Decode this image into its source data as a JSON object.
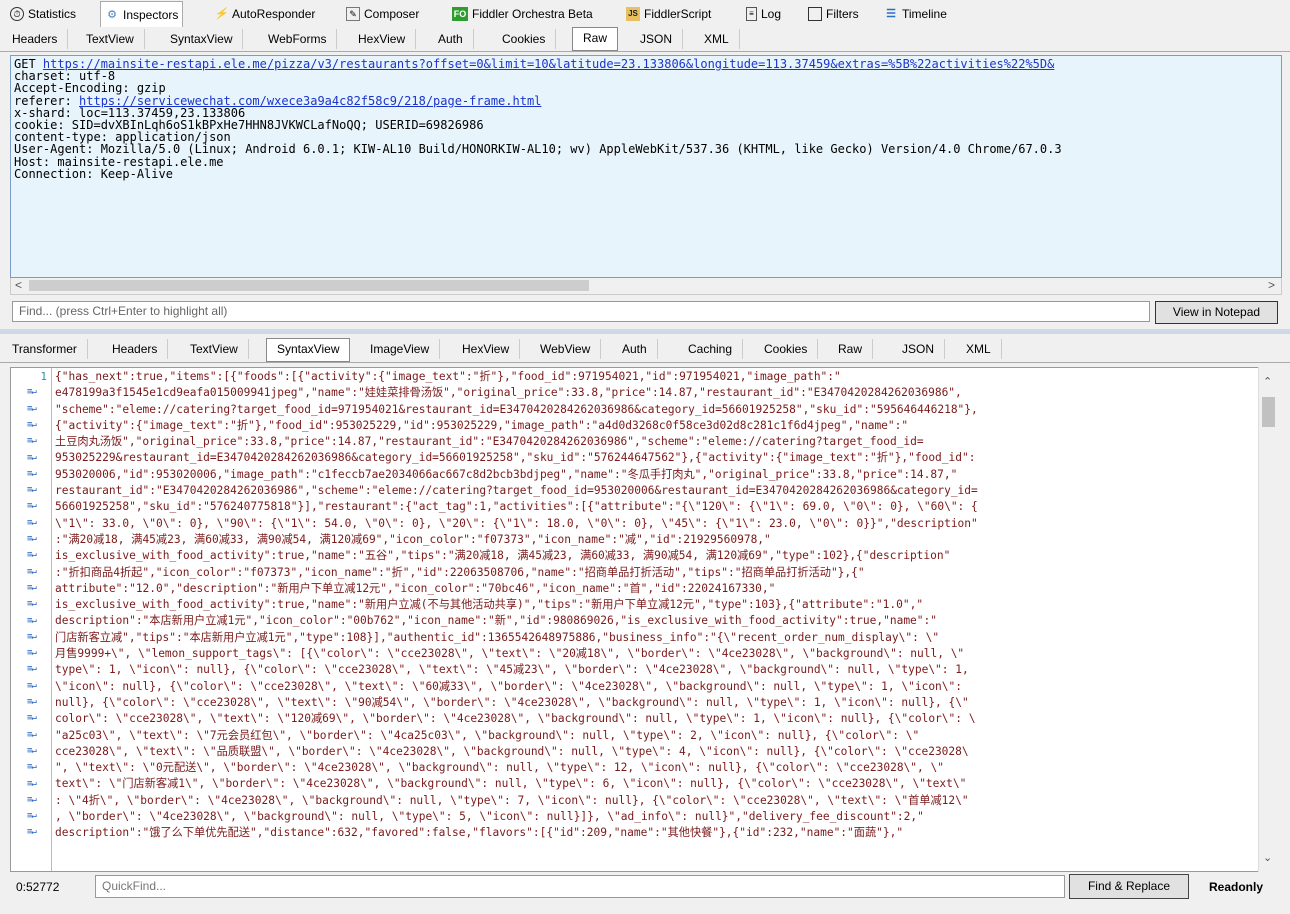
{
  "top_tabs": [
    {
      "label": "Statistics",
      "icon": "stopwatch-icon"
    },
    {
      "label": "Inspectors",
      "icon": "inspector-icon"
    },
    {
      "label": "AutoResponder",
      "icon": "lightning-icon"
    },
    {
      "label": "Composer",
      "icon": "composer-icon"
    },
    {
      "label": "Fiddler Orchestra Beta",
      "icon": "fo-icon"
    },
    {
      "label": "FiddlerScript",
      "icon": "script-icon"
    },
    {
      "label": "Log",
      "icon": "log-icon"
    },
    {
      "label": "Filters",
      "icon": "filter-checkbox-icon"
    },
    {
      "label": "Timeline",
      "icon": "timeline-icon"
    }
  ],
  "request_tabs": [
    "Headers",
    "TextView",
    "SyntaxView",
    "WebForms",
    "HexView",
    "Auth",
    "Cookies",
    "Raw",
    "JSON",
    "XML"
  ],
  "request_active_tab": "Raw",
  "raw": {
    "method": "GET ",
    "url": "https://mainsite-restapi.ele.me/pizza/v3/restaurants?offset=0&limit=10&latitude=23.133806&longitude=113.37459&extras=%5B%22activities%22%5D&",
    "line_charset": "charset: utf-8",
    "line_encoding": "Accept-Encoding: gzip",
    "referer_label": "referer: ",
    "referer_url": "https://servicewechat.com/wxece3a9a4c82f58c9/218/page-frame.html",
    "line_xshard": "x-shard: loc=113.37459,23.133806",
    "line_cookie": "cookie: SID=dvXBInLqh6oS1kBPxHe7HHN8JVKWCLafNoQQ; USERID=69826986",
    "line_ctype": "content-type: application/json",
    "line_ua": "User-Agent: Mozilla/5.0 (Linux; Android 6.0.1; KIW-AL10 Build/HONORKIW-AL10; wv) AppleWebKit/537.36 (KHTML, like Gecko) Version/4.0 Chrome/67.0.3",
    "line_host": "Host: mainsite-restapi.ele.me",
    "line_conn": "Connection: Keep-Alive"
  },
  "find_placeholder": "Find... (press Ctrl+Enter to highlight all)",
  "view_notepad": "View in Notepad",
  "response_tabs": [
    "Transformer",
    "Headers",
    "TextView",
    "SyntaxView",
    "ImageView",
    "HexView",
    "WebView",
    "Auth",
    "Caching",
    "Cookies",
    "Raw",
    "JSON",
    "XML"
  ],
  "response_active_tab": "SyntaxView",
  "line_number": "1",
  "code_lines": [
    "{\"has_next\":true,\"items\":[{\"foods\":[{\"activity\":{\"image_text\":\"折\"},\"food_id\":971954021,\"id\":971954021,\"image_path\":\"",
    "e478199a3f1545e1cd9eafa015009941jpeg\",\"name\":\"娃娃菜排骨汤饭\",\"original_price\":33.8,\"price\":14.87,\"restaurant_id\":\"E3470420284262036986\",",
    "\"scheme\":\"eleme://catering?target_food_id=971954021&restaurant_id=E3470420284262036986&category_id=56601925258\",\"sku_id\":\"595646446218\"},",
    "{\"activity\":{\"image_text\":\"折\"},\"food_id\":953025229,\"id\":953025229,\"image_path\":\"a4d0d3268c0f58ce3d02d8c281c1f6d4jpeg\",\"name\":\"",
    "土豆肉丸汤饭\",\"original_price\":33.8,\"price\":14.87,\"restaurant_id\":\"E3470420284262036986\",\"scheme\":\"eleme://catering?target_food_id=",
    "953025229&restaurant_id=E3470420284262036986&category_id=56601925258\",\"sku_id\":\"576244647562\"},{\"activity\":{\"image_text\":\"折\"},\"food_id\":",
    "953020006,\"id\":953020006,\"image_path\":\"c1feccb7ae2034066ac667c8d2bcb3bdjpeg\",\"name\":\"冬瓜手打肉丸\",\"original_price\":33.8,\"price\":14.87,\"",
    "restaurant_id\":\"E3470420284262036986\",\"scheme\":\"eleme://catering?target_food_id=953020006&restaurant_id=E3470420284262036986&category_id=",
    "56601925258\",\"sku_id\":\"576240775818\"}],\"restaurant\":{\"act_tag\":1,\"activities\":[{\"attribute\":\"{\\\"120\\\": {\\\"1\\\": 69.0, \\\"0\\\": 0}, \\\"60\\\": {",
    "\\\"1\\\": 33.0, \\\"0\\\": 0}, \\\"90\\\": {\\\"1\\\": 54.0, \\\"0\\\": 0}, \\\"20\\\": {\\\"1\\\": 18.0, \\\"0\\\": 0}, \\\"45\\\": {\\\"1\\\": 23.0, \\\"0\\\": 0}}\",\"description\"",
    ":\"满20减18, 满45减23, 满60减33, 满90减54, 满120减69\",\"icon_color\":\"f07373\",\"icon_name\":\"减\",\"id\":21929560978,\"",
    "is_exclusive_with_food_activity\":true,\"name\":\"五谷\",\"tips\":\"满20减18, 满45减23, 满60减33, 满90减54, 满120减69\",\"type\":102},{\"description\"",
    ":\"折扣商品4折起\",\"icon_color\":\"f07373\",\"icon_name\":\"折\",\"id\":22063508706,\"name\":\"招商单品打折活动\",\"tips\":\"招商单品打折活动\"},{\"",
    "attribute\":\"12.0\",\"description\":\"新用户下单立减12元\",\"icon_color\":\"70bc46\",\"icon_name\":\"首\",\"id\":22024167330,\"",
    "is_exclusive_with_food_activity\":true,\"name\":\"新用户立减(不与其他活动共享)\",\"tips\":\"新用户下单立减12元\",\"type\":103},{\"attribute\":\"1.0\",\"",
    "description\":\"本店新用户立减1元\",\"icon_color\":\"00b762\",\"icon_name\":\"新\",\"id\":980869026,\"is_exclusive_with_food_activity\":true,\"name\":\"",
    "门店新客立减\",\"tips\":\"本店新用户立减1元\",\"type\":108}],\"authentic_id\":1365542648975886,\"business_info\":\"{\\\"recent_order_num_display\\\": \\\"",
    "月售9999+\\\", \\\"lemon_support_tags\\\": [{\\\"color\\\": \\\"cce23028\\\", \\\"text\\\": \\\"20减18\\\", \\\"border\\\": \\\"4ce23028\\\", \\\"background\\\": null, \\\"",
    "type\\\": 1, \\\"icon\\\": null}, {\\\"color\\\": \\\"cce23028\\\", \\\"text\\\": \\\"45减23\\\", \\\"border\\\": \\\"4ce23028\\\", \\\"background\\\": null, \\\"type\\\": 1,",
    "\\\"icon\\\": null}, {\\\"color\\\": \\\"cce23028\\\", \\\"text\\\": \\\"60减33\\\", \\\"border\\\": \\\"4ce23028\\\", \\\"background\\\": null, \\\"type\\\": 1, \\\"icon\\\":",
    "null}, {\\\"color\\\": \\\"cce23028\\\", \\\"text\\\": \\\"90减54\\\", \\\"border\\\": \\\"4ce23028\\\", \\\"background\\\": null, \\\"type\\\": 1, \\\"icon\\\": null}, {\\\"",
    "color\\\": \\\"cce23028\\\", \\\"text\\\": \\\"120减69\\\", \\\"border\\\": \\\"4ce23028\\\", \\\"background\\\": null, \\\"type\\\": 1, \\\"icon\\\": null}, {\\\"color\\\": \\",
    "\"a25c03\\\", \\\"text\\\": \\\"7元会员红包\\\", \\\"border\\\": \\\"4ca25c03\\\", \\\"background\\\": null, \\\"type\\\": 2, \\\"icon\\\": null}, {\\\"color\\\": \\\"",
    "cce23028\\\", \\\"text\\\": \\\"品质联盟\\\", \\\"border\\\": \\\"4ce23028\\\", \\\"background\\\": null, \\\"type\\\": 4, \\\"icon\\\": null}, {\\\"color\\\": \\\"cce23028\\",
    "\", \\\"text\\\": \\\"0元配送\\\", \\\"border\\\": \\\"4ce23028\\\", \\\"background\\\": null, \\\"type\\\": 12, \\\"icon\\\": null}, {\\\"color\\\": \\\"cce23028\\\", \\\"",
    "text\\\": \\\"门店新客减1\\\", \\\"border\\\": \\\"4ce23028\\\", \\\"background\\\": null, \\\"type\\\": 6, \\\"icon\\\": null}, {\\\"color\\\": \\\"cce23028\\\", \\\"text\\\"",
    ": \\\"4折\\\", \\\"border\\\": \\\"4ce23028\\\", \\\"background\\\": null, \\\"type\\\": 7, \\\"icon\\\": null}, {\\\"color\\\": \\\"cce23028\\\", \\\"text\\\": \\\"首单减12\\\"",
    ", \\\"border\\\": \\\"4ce23028\\\", \\\"background\\\": null, \\\"type\\\": 5, \\\"icon\\\": null}]}, \\\"ad_info\\\": null}\",\"delivery_fee_discount\":2,\"",
    "description\":\"饿了么下单优先配送\",\"distance\":632,\"favored\":false,\"flavors\":[{\"id\":209,\"name\":\"其他快餐\"},{\"id\":232,\"name\":\"面蔬\"},\""
  ],
  "cursor_position": "0:52772",
  "quickfind_placeholder": "QuickFind...",
  "find_replace": "Find & Replace",
  "readonly": "Readonly"
}
